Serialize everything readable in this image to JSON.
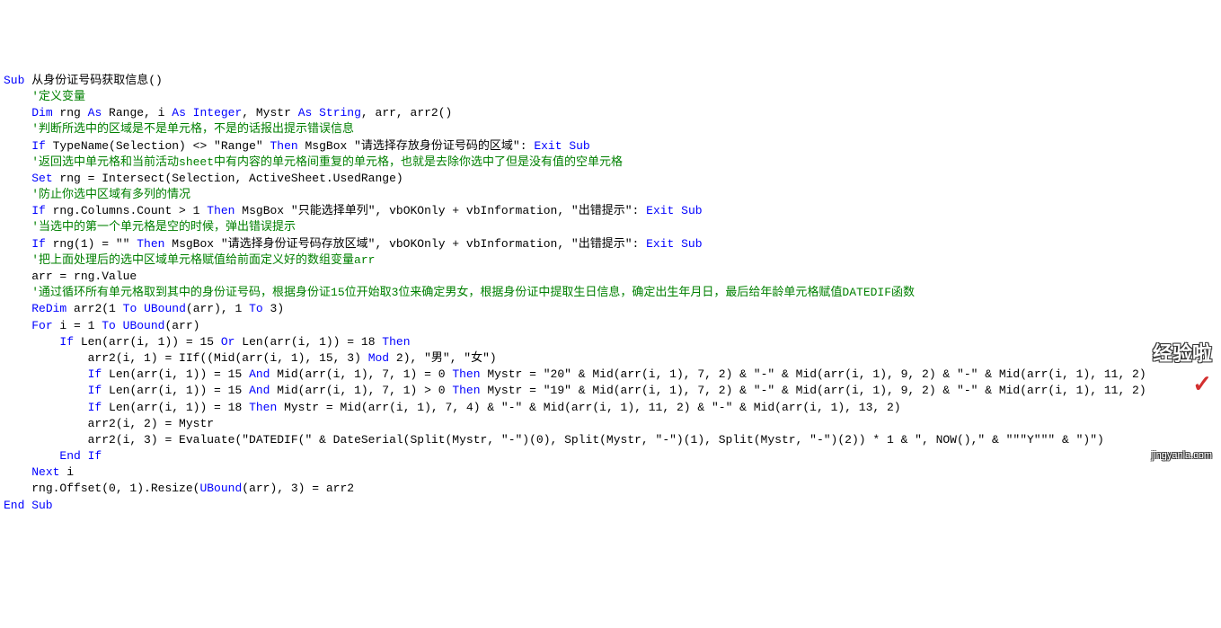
{
  "code": {
    "lines": [
      {
        "indent": 0,
        "segments": [
          {
            "c": "kw",
            "t": "Sub"
          },
          {
            "c": "txt",
            "t": " 从身份证号码获取信息()"
          }
        ]
      },
      {
        "indent": 1,
        "segments": [
          {
            "c": "cm",
            "t": "'定义变量"
          }
        ]
      },
      {
        "indent": 1,
        "segments": [
          {
            "c": "kw",
            "t": "Dim"
          },
          {
            "c": "txt",
            "t": " rng "
          },
          {
            "c": "kw",
            "t": "As"
          },
          {
            "c": "txt",
            "t": " Range, i "
          },
          {
            "c": "kw",
            "t": "As Integer"
          },
          {
            "c": "txt",
            "t": ", Mystr "
          },
          {
            "c": "kw",
            "t": "As String"
          },
          {
            "c": "txt",
            "t": ", arr, arr2()"
          }
        ]
      },
      {
        "indent": 0,
        "segments": [
          {
            "c": "txt",
            "t": ""
          }
        ]
      },
      {
        "indent": 1,
        "segments": [
          {
            "c": "cm",
            "t": "'判断所选中的区域是不是单元格，不是的话报出提示错误信息"
          }
        ]
      },
      {
        "indent": 1,
        "segments": [
          {
            "c": "kw",
            "t": "If"
          },
          {
            "c": "txt",
            "t": " TypeName(Selection) <> \"Range\" "
          },
          {
            "c": "kw",
            "t": "Then"
          },
          {
            "c": "txt",
            "t": " MsgBox \"请选择存放身份证号码的区域\": "
          },
          {
            "c": "kw",
            "t": "Exit Sub"
          }
        ]
      },
      {
        "indent": 0,
        "segments": [
          {
            "c": "txt",
            "t": ""
          }
        ]
      },
      {
        "indent": 1,
        "segments": [
          {
            "c": "cm",
            "t": "'返回选中单元格和当前活动sheet中有内容的单元格间重复的单元格，也就是去除你选中了但是没有值的空单元格"
          }
        ]
      },
      {
        "indent": 1,
        "segments": [
          {
            "c": "kw",
            "t": "Set"
          },
          {
            "c": "txt",
            "t": " rng = Intersect(Selection, ActiveSheet.UsedRange)"
          }
        ]
      },
      {
        "indent": 0,
        "segments": [
          {
            "c": "txt",
            "t": ""
          }
        ]
      },
      {
        "indent": 1,
        "segments": [
          {
            "c": "cm",
            "t": "'防止你选中区域有多列的情况"
          }
        ]
      },
      {
        "indent": 1,
        "segments": [
          {
            "c": "kw",
            "t": "If"
          },
          {
            "c": "txt",
            "t": " rng.Columns.Count > 1 "
          },
          {
            "c": "kw",
            "t": "Then"
          },
          {
            "c": "txt",
            "t": " MsgBox \"只能选择单列\", vbOKOnly + vbInformation, \"出错提示\": "
          },
          {
            "c": "kw",
            "t": "Exit Sub"
          }
        ]
      },
      {
        "indent": 0,
        "segments": [
          {
            "c": "txt",
            "t": ""
          }
        ]
      },
      {
        "indent": 1,
        "segments": [
          {
            "c": "cm",
            "t": "'当选中的第一个单元格是空的时候，弹出错误提示"
          }
        ]
      },
      {
        "indent": 1,
        "segments": [
          {
            "c": "kw",
            "t": "If"
          },
          {
            "c": "txt",
            "t": " rng(1) = \"\" "
          },
          {
            "c": "kw",
            "t": "Then"
          },
          {
            "c": "txt",
            "t": " MsgBox \"请选择身份证号码存放区域\", vbOKOnly + vbInformation, \"出错提示\": "
          },
          {
            "c": "kw",
            "t": "Exit Sub"
          }
        ]
      },
      {
        "indent": 0,
        "segments": [
          {
            "c": "txt",
            "t": ""
          }
        ]
      },
      {
        "indent": 1,
        "segments": [
          {
            "c": "cm",
            "t": "'把上面处理后的选中区域单元格赋值给前面定义好的数组变量arr"
          }
        ]
      },
      {
        "indent": 1,
        "segments": [
          {
            "c": "txt",
            "t": "arr = rng.Value"
          }
        ]
      },
      {
        "indent": 0,
        "segments": [
          {
            "c": "txt",
            "t": ""
          }
        ]
      },
      {
        "indent": 1,
        "segments": [
          {
            "c": "cm",
            "t": "'通过循环所有单元格取到其中的身份证号码，根据身份证15位开始取3位来确定男女，根据身份证中提取生日信息，确定出生年月日，最后给年龄单元格赋值DATEDIF函数"
          }
        ]
      },
      {
        "indent": 1,
        "segments": [
          {
            "c": "kw",
            "t": "ReDim"
          },
          {
            "c": "txt",
            "t": " arr2(1 "
          },
          {
            "c": "kw",
            "t": "To"
          },
          {
            "c": "txt",
            "t": " "
          },
          {
            "c": "kw",
            "t": "UBound"
          },
          {
            "c": "txt",
            "t": "(arr), 1 "
          },
          {
            "c": "kw",
            "t": "To"
          },
          {
            "c": "txt",
            "t": " 3)"
          }
        ]
      },
      {
        "indent": 1,
        "segments": [
          {
            "c": "kw",
            "t": "For"
          },
          {
            "c": "txt",
            "t": " i = 1 "
          },
          {
            "c": "kw",
            "t": "To UBound"
          },
          {
            "c": "txt",
            "t": "(arr)"
          }
        ]
      },
      {
        "indent": 2,
        "segments": [
          {
            "c": "kw",
            "t": "If"
          },
          {
            "c": "txt",
            "t": " Len(arr(i, 1)) = 15 "
          },
          {
            "c": "kw",
            "t": "Or"
          },
          {
            "c": "txt",
            "t": " Len(arr(i, 1)) = 18 "
          },
          {
            "c": "kw",
            "t": "Then"
          }
        ]
      },
      {
        "indent": 3,
        "segments": [
          {
            "c": "txt",
            "t": "arr2(i, 1) = IIf((Mid(arr(i, 1), 15, 3) "
          },
          {
            "c": "kw",
            "t": "Mod"
          },
          {
            "c": "txt",
            "t": " 2), \"男\", \"女\")"
          }
        ]
      },
      {
        "indent": 3,
        "segments": [
          {
            "c": "kw",
            "t": "If"
          },
          {
            "c": "txt",
            "t": " Len(arr(i, 1)) = 15 "
          },
          {
            "c": "kw",
            "t": "And"
          },
          {
            "c": "txt",
            "t": " Mid(arr(i, 1), 7, 1) = 0 "
          },
          {
            "c": "kw",
            "t": "Then"
          },
          {
            "c": "txt",
            "t": " Mystr = \"20\" & Mid(arr(i, 1), 7, 2) & \"-\" & Mid(arr(i, 1), 9, 2) & \"-\" & Mid(arr(i, 1), 11, 2)"
          }
        ]
      },
      {
        "indent": 3,
        "segments": [
          {
            "c": "kw",
            "t": "If"
          },
          {
            "c": "txt",
            "t": " Len(arr(i, 1)) = 15 "
          },
          {
            "c": "kw",
            "t": "And"
          },
          {
            "c": "txt",
            "t": " Mid(arr(i, 1), 7, 1) > 0 "
          },
          {
            "c": "kw",
            "t": "Then"
          },
          {
            "c": "txt",
            "t": " Mystr = \"19\" & Mid(arr(i, 1), 7, 2) & \"-\" & Mid(arr(i, 1), 9, 2) & \"-\" & Mid(arr(i, 1), 11, 2)"
          }
        ]
      },
      {
        "indent": 3,
        "segments": [
          {
            "c": "kw",
            "t": "If"
          },
          {
            "c": "txt",
            "t": " Len(arr(i, 1)) = 18 "
          },
          {
            "c": "kw",
            "t": "Then"
          },
          {
            "c": "txt",
            "t": " Mystr = Mid(arr(i, 1), 7, 4) & \"-\" & Mid(arr(i, 1), 11, 2) & \"-\" & Mid(arr(i, 1), 13, 2)"
          }
        ]
      },
      {
        "indent": 3,
        "segments": [
          {
            "c": "txt",
            "t": "arr2(i, 2) = Mystr"
          }
        ]
      },
      {
        "indent": 3,
        "segments": [
          {
            "c": "txt",
            "t": "arr2(i, 3) = Evaluate(\"DATEDIF(\" & DateSerial(Split(Mystr, \"-\")(0), Split(Mystr, \"-\")(1), Split(Mystr, \"-\")(2)) * 1 & \", NOW(),\" & \"\"\"Y\"\"\" & \")\")"
          }
        ]
      },
      {
        "indent": 2,
        "segments": [
          {
            "c": "kw",
            "t": "End If"
          }
        ]
      },
      {
        "indent": 1,
        "segments": [
          {
            "c": "kw",
            "t": "Next"
          },
          {
            "c": "txt",
            "t": " i"
          }
        ]
      },
      {
        "indent": 1,
        "segments": [
          {
            "c": "txt",
            "t": "rng.Offset(0, 1).Resize("
          },
          {
            "c": "kw",
            "t": "UBound"
          },
          {
            "c": "txt",
            "t": "(arr), 3) = arr2"
          }
        ]
      },
      {
        "indent": 0,
        "segments": [
          {
            "c": "kw",
            "t": "End Sub"
          }
        ]
      }
    ]
  },
  "watermark": {
    "main": "经验啦",
    "check": "✓",
    "sub": "jingyanla.com"
  }
}
